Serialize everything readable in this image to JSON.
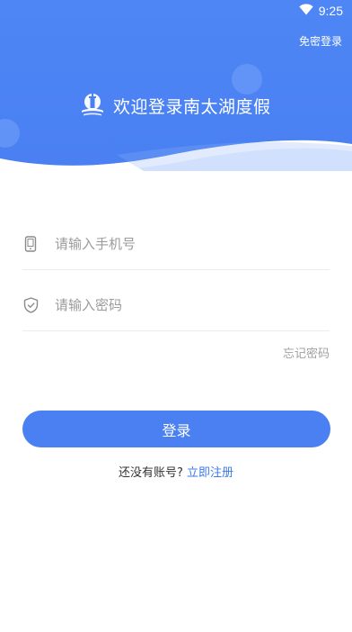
{
  "status_bar": {
    "time": "9:25",
    "wifi_icon": "wifi-icon"
  },
  "header": {
    "nologin_label": "免密登录",
    "app_title": "欢迎登录南太湖度假",
    "logo_icon": "tower-logo-icon"
  },
  "form": {
    "phone": {
      "placeholder": "请输入手机号",
      "value": "",
      "icon": "phone-icon"
    },
    "password": {
      "placeholder": "请输入密码",
      "value": "",
      "icon": "shield-icon"
    },
    "forgot_label": "忘记密码",
    "login_label": "登录"
  },
  "register": {
    "question": "还没有账号?",
    "link_label": "立即注册"
  },
  "colors": {
    "primary": "#4a80f2",
    "link": "#3d7ae8"
  }
}
